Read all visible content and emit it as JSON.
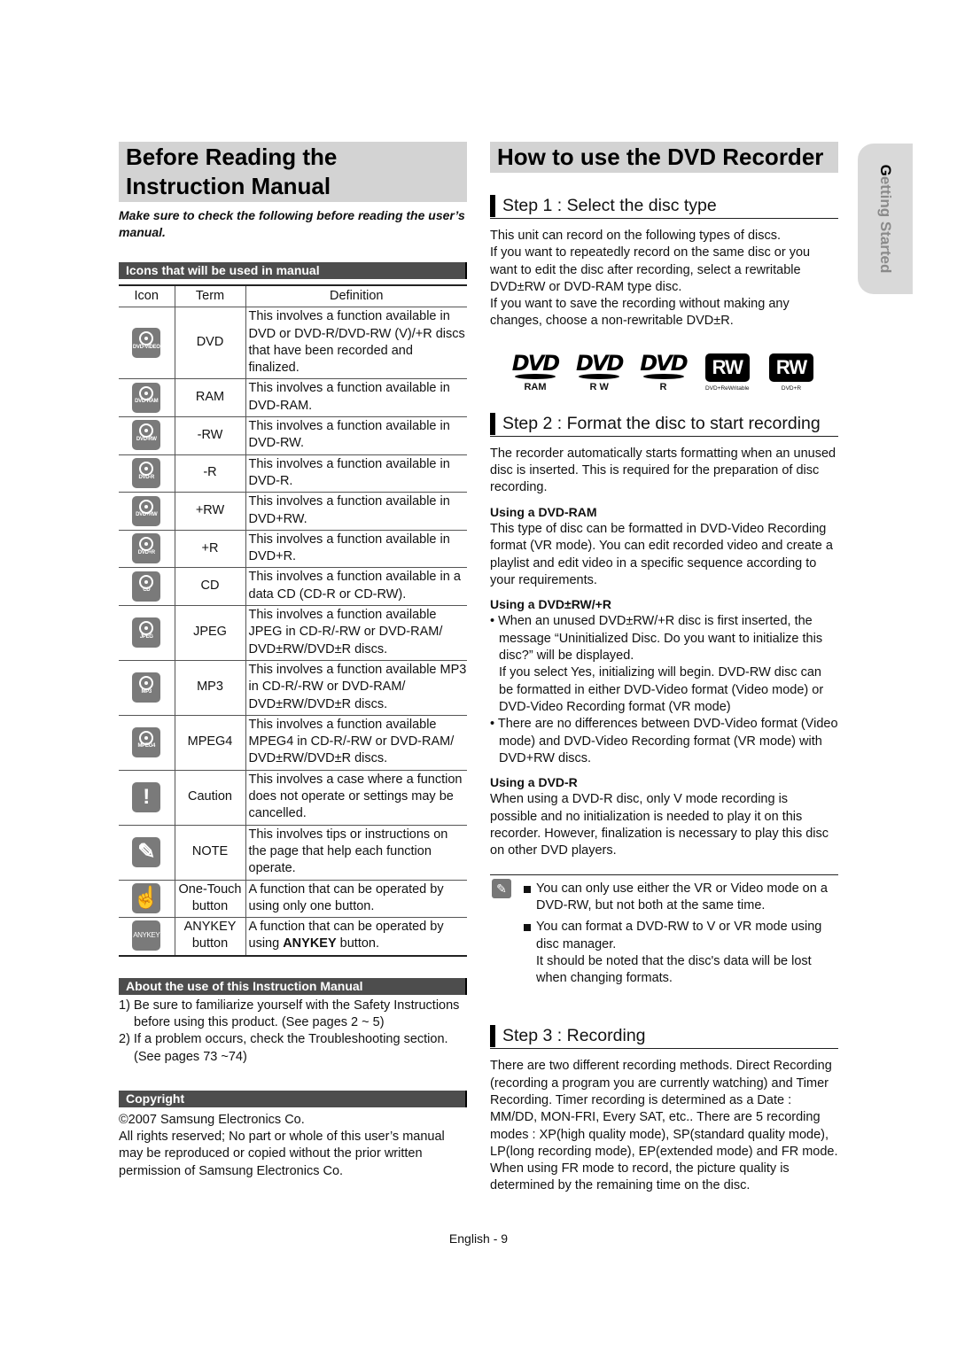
{
  "left": {
    "title": "Before Reading the Instruction Manual",
    "intro": "Make sure to check the following before reading the user’s manual.",
    "icons_section": {
      "heading": "Icons that will be used in manual",
      "columns": [
        "Icon",
        "Term",
        "Definition"
      ],
      "rows": [
        {
          "icon": "dvd-video-icon",
          "icon_label": "DVD-VIDEO",
          "term": "DVD",
          "definition": "This involves a function available in DVD or DVD-R/DVD-RW (V)/+R discs that have been recorded and finalized."
        },
        {
          "icon": "dvd-ram-icon",
          "icon_label": "DVD-RAM",
          "term": "RAM",
          "definition": "This involves a function available in DVD-RAM."
        },
        {
          "icon": "dvd-rw-icon",
          "icon_label": "DVD-RW",
          "term": "-RW",
          "definition": "This involves a function available in DVD-RW."
        },
        {
          "icon": "dvd-r-icon",
          "icon_label": "DVD-R",
          "term": "-R",
          "definition": "This involves a function available in DVD-R."
        },
        {
          "icon": "dvd-plus-rw-icon",
          "icon_label": "DVD+RW",
          "term": "+RW",
          "definition": "This involves a function available in DVD+RW."
        },
        {
          "icon": "dvd-plus-r-icon",
          "icon_label": "DVD+R",
          "term": "+R",
          "definition": "This involves a function available in DVD+R."
        },
        {
          "icon": "cd-icon",
          "icon_label": "CD",
          "term": "CD",
          "definition": "This involves a function available in a data CD (CD-R or CD-RW)."
        },
        {
          "icon": "jpeg-icon",
          "icon_label": "JPEG",
          "term": "JPEG",
          "definition": "This involves a function available JPEG in CD-R/-RW or DVD-RAM/ DVD±RW/DVD±R discs."
        },
        {
          "icon": "mp3-icon",
          "icon_label": "MP3",
          "term": "MP3",
          "definition": "This involves a function available MP3 in CD-R/-RW or DVD-RAM/ DVD±RW/DVD±R discs."
        },
        {
          "icon": "mpeg4-icon",
          "icon_label": "MPEG4",
          "term": "MPEG4",
          "definition": "This involves a function available MPEG4 in CD-R/-RW or DVD-RAM/ DVD±RW/DVD±R discs."
        },
        {
          "icon": "caution-icon",
          "icon_glyph": "!",
          "term": "Caution",
          "definition": "This involves a case where a function does not operate or settings may be cancelled."
        },
        {
          "icon": "note-pencil-icon",
          "icon_glyph": "✎",
          "term": "NOTE",
          "definition": "This involves tips or instructions on the page that help each function operate."
        },
        {
          "icon": "one-touch-hand-icon",
          "icon_glyph": "☝",
          "term": "One-Touch button",
          "definition": "A function that can be operated by using only one button."
        },
        {
          "icon": "anykey-icon",
          "icon_glyph": "ANYKEY",
          "term": "ANYKEY button",
          "definition_prefix": "A function that can be operated by using ",
          "definition_bold": "ANYKEY",
          "definition_suffix": " button."
        }
      ]
    },
    "about_section": {
      "heading": "About the use of this Instruction Manual",
      "items": [
        "1) Be sure to familiarize yourself with the Safety Instructions before using this product. (See pages 2 ~ 5)",
        "2) If a problem occurs, check the Troubleshooting section. (See pages 73 ~74)"
      ]
    },
    "copyright_section": {
      "heading": "Copyright",
      "line1": "©2007 Samsung Electronics Co.",
      "line2": "All rights reserved; No part or whole of this user’s manual may be reproduced or copied without the prior written permission of Samsung Electronics Co."
    }
  },
  "right": {
    "title": "How to use the DVD Recorder",
    "step1": {
      "heading": "Step 1 : Select the disc type",
      "text1": "This unit can record on the following types of discs.",
      "text2": "If you want to repeatedly record on the same disc or you want to edit the disc after recording, select a rewritable DVD±RW or DVD-RAM type disc.",
      "text3": "If you want to save the recording without making any changes, choose a non-rewritable DVD±R.",
      "logos": [
        {
          "mark": "DVD",
          "caption": "RAM"
        },
        {
          "mark": "DVD",
          "caption": "R W"
        },
        {
          "mark": "DVD",
          "caption": "R"
        },
        {
          "mark": "RW",
          "caption": "DVD+ReWritable"
        },
        {
          "mark": "RW",
          "caption": "DVD+R"
        }
      ]
    },
    "step2": {
      "heading": "Step 2 : Format the disc to start recording",
      "intro": "The recorder automatically starts formatting when an unused disc is inserted. This is required for the preparation of disc recording.",
      "ram_heading": "Using a DVD-RAM",
      "ram_text": "This type of disc can be formatted in DVD-Video Recording format (VR mode). You can edit recorded video and create a playlist and edit video in a specific sequence according to your requirements.",
      "rw_heading": "Using a DVD±RW/+R",
      "rw_bullet1": "When an unused DVD±RW/+R disc is first inserted, the message “Uninitialized Disc. Do you want to initialize this disc?” will be displayed.",
      "rw_bullet1_cont": "If you select Yes, initializing will begin. DVD-RW disc can be formatted in either DVD-Video format (Video mode) or DVD-Video Recording format (VR mode)",
      "rw_bullet2": "There are no differences between DVD-Video format (Video mode) and DVD-Video Recording format (VR mode) with DVD+RW discs.",
      "r_heading": "Using a DVD-R",
      "r_text": "When using a DVD-R disc, only V mode recording is possible and no initialization is needed to play it on this recorder. However, finalization is necessary to play this disc on other DVD players.",
      "notes": [
        "You can only use either the VR or Video mode on a DVD-RW, but not both at the same time.",
        "You can format a DVD-RW to V or VR mode using disc manager."
      ],
      "note2_cont": "It should be noted that the disc's data will be lost when changing formats."
    },
    "step3": {
      "heading": "Step 3 : Recording",
      "text": "There are two different recording methods. Direct Recording (recording a program you are currently watching) and Timer Recording. Timer recording is determined as a Date : MM/DD, MON-FRI, Every SAT, etc.. There are 5 recording modes : XP(high quality mode), SP(standard quality mode), LP(long recording mode), EP(extended mode) and FR mode. When using FR mode to record, the picture quality is determined by the remaining time on the disc."
    }
  },
  "side_tab": {
    "first_letter": "G",
    "rest": "etting Started"
  },
  "footer": {
    "page": "English - 9"
  }
}
